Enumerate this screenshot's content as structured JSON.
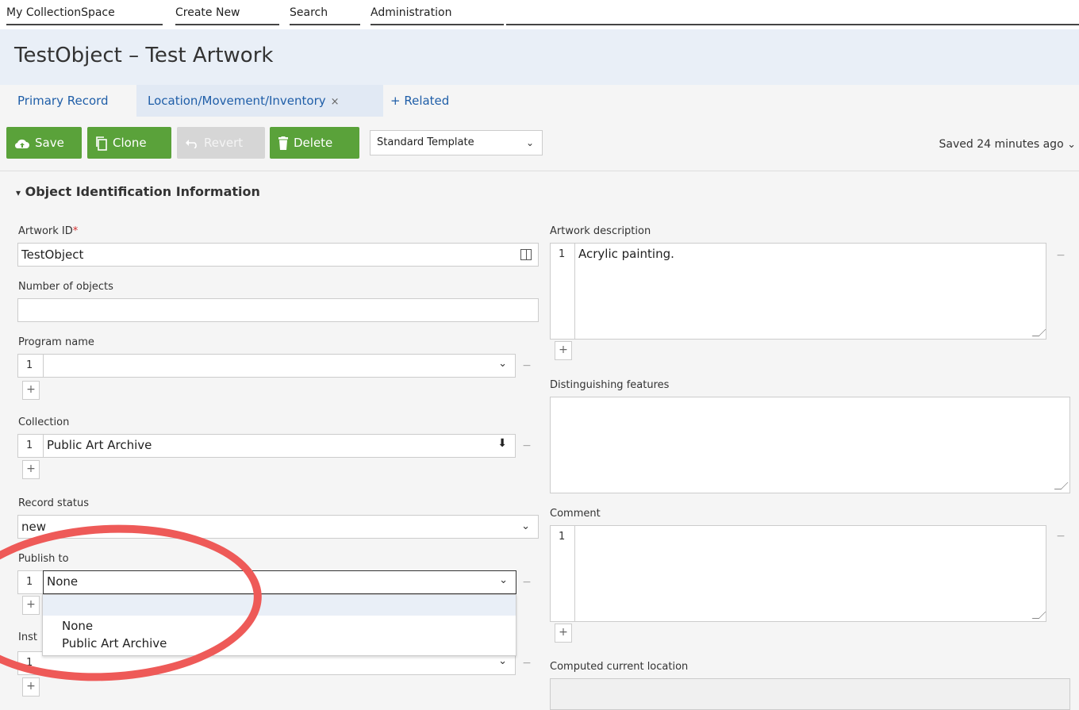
{
  "nav": {
    "my_collectionspace": "My CollectionSpace",
    "create_new": "Create New",
    "search": "Search",
    "administration": "Administration"
  },
  "header": {
    "title": "TestObject – Test Artwork"
  },
  "tabs": {
    "primary": "Primary Record",
    "location": "Location/Movement/Inventory",
    "location_close": "×",
    "related": "+ Related"
  },
  "toolbar": {
    "save": "Save",
    "clone": "Clone",
    "revert": "Revert",
    "delete": "Delete",
    "template": "Standard Template",
    "saved_status": "Saved 24 minutes ago"
  },
  "section": {
    "title": "Object Identification Information",
    "toggle": "▾"
  },
  "fields": {
    "artwork_id": {
      "label": "Artwork ID",
      "required": "*",
      "value": "TestObject"
    },
    "number_of_objects": {
      "label": "Number of objects",
      "value": ""
    },
    "program_name": {
      "label": "Program name",
      "row": "1",
      "value": ""
    },
    "collection": {
      "label": "Collection",
      "row": "1",
      "value": "Public Art Archive"
    },
    "record_status": {
      "label": "Record status",
      "value": "new"
    },
    "publish_to": {
      "label": "Publish to",
      "row": "1",
      "value": "None",
      "options": [
        "None",
        "Public Art Archive"
      ]
    },
    "inst_partial": {
      "label": "Inst",
      "row": "1"
    },
    "artwork_description": {
      "label": "Artwork description",
      "row": "1",
      "value": "Acrylic painting."
    },
    "distinguishing_features": {
      "label": "Distinguishing features",
      "value": ""
    },
    "comment": {
      "label": "Comment",
      "row": "1",
      "value": ""
    },
    "computed_current_location": {
      "label": "Computed current location",
      "value": ""
    }
  },
  "glyphs": {
    "plus": "+",
    "minus": "−",
    "chevron": "⌄"
  },
  "colors": {
    "accent_green": "#5aa23a",
    "link_blue": "#1f5ea8",
    "annotation_red": "#ee5a58",
    "header_bg": "#e9eff7"
  }
}
